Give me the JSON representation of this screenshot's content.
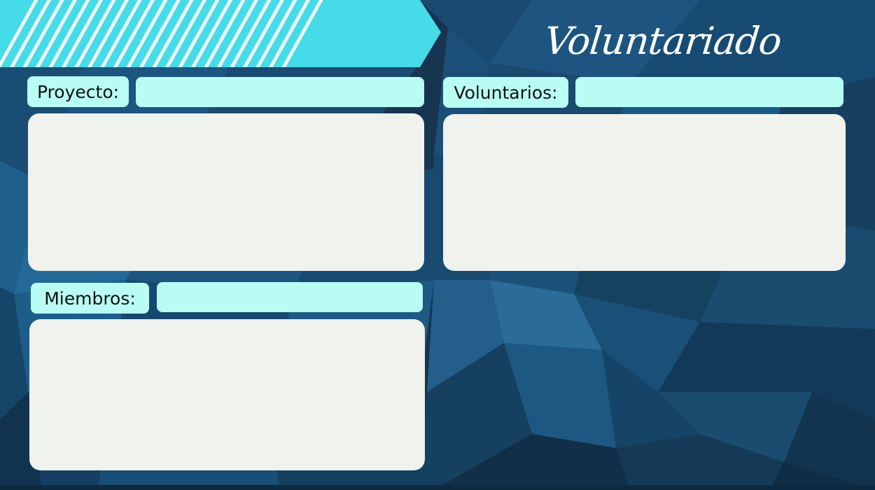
{
  "header": {
    "title": "Voluntariado"
  },
  "colors": {
    "accent": "#45dbe8",
    "field": "#b8fcf4",
    "panel": "#f0f2ee",
    "background": "#16324a"
  },
  "proyecto": {
    "label": "Proyecto:",
    "value": "",
    "notes": ""
  },
  "voluntarios": {
    "label": "Voluntarios:",
    "value": "",
    "notes": ""
  },
  "miembros": {
    "label": "Miembros:",
    "value": "",
    "notes": ""
  }
}
